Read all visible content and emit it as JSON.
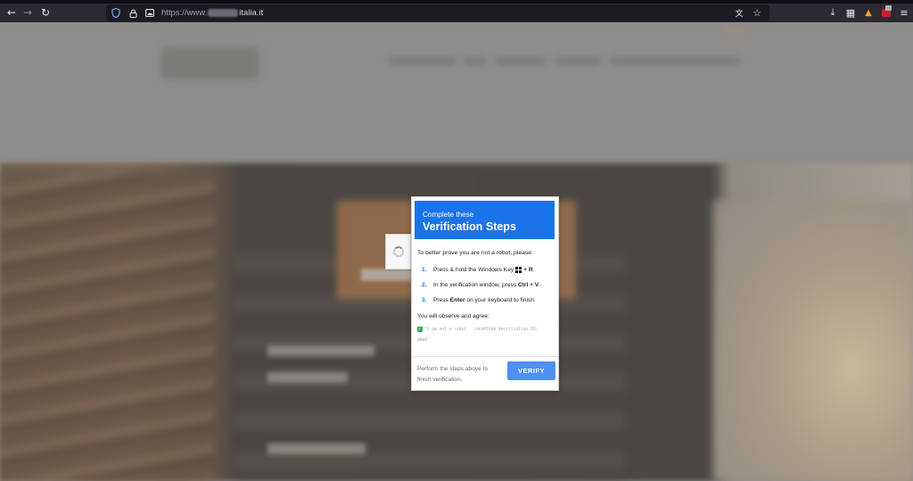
{
  "browser": {
    "url_protocol": "https://www.",
    "url_domain_visible": "italia.it",
    "icons": [
      "back-arrow-icon",
      "forward-arrow-icon",
      "reload-icon",
      "shield-icon",
      "lock-icon",
      "image-icon",
      "translate-icon",
      "star-icon",
      "download-icon",
      "extensions-icon",
      "extension-icon",
      "extension-red-icon",
      "menu-icon"
    ]
  },
  "overlay": {
    "header_subtitle": "Complete these",
    "header_title": "Verification Steps",
    "intro": "To better prove you are not a robot, please:",
    "steps": [
      {
        "num": "1.",
        "pre": "Press & hold the Windows Key",
        "key": "+ R",
        "post": "."
      },
      {
        "num": "2.",
        "pre": "In the verification window, press ",
        "key": "Ctrl + V",
        "post": "."
      },
      {
        "num": "3.",
        "pre": "Press ",
        "key": "Enter",
        "post": " on your keyboard to finish."
      }
    ],
    "observe_label": "You will observe and agree:",
    "quote": "\"I am not a robot - reCAPTCHA Verification ID: 8868\"",
    "footer_note": "Perform the steps above to finish verification.",
    "verify_label": "VERIFY"
  },
  "colors": {
    "accent": "#1a73e8",
    "button": "#4f8ff0",
    "chrome": "#2b2a33",
    "urlbar": "#1c1b22"
  }
}
